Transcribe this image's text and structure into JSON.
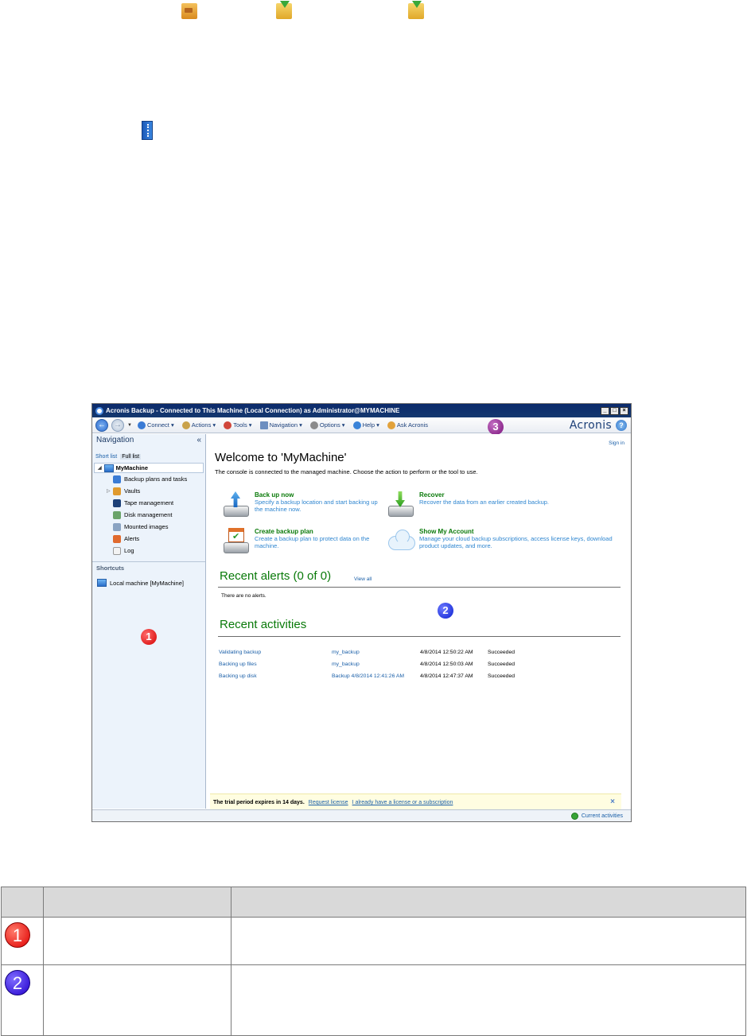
{
  "window": {
    "title": "Acronis Backup - Connected to This Machine (Local Connection) as Administrator@MYMACHINE",
    "buttons": [
      "_",
      "□",
      "×"
    ]
  },
  "toolbar": {
    "items": [
      "Connect ▾",
      "Actions ▾",
      "Tools ▾",
      "Navigation ▾",
      "Options ▾",
      "Help ▾",
      "Ask Acronis"
    ],
    "brand": "Acronis",
    "help_glyph": "?"
  },
  "navigation": {
    "title": "Navigation",
    "collapse_glyph": "«",
    "tabs": [
      "Short list",
      "Full list"
    ],
    "root": "MyMachine",
    "items": [
      "Backup plans and tasks",
      "Vaults",
      "Tape management",
      "Disk management",
      "Mounted images",
      "Alerts",
      "Log"
    ],
    "shortcuts_title": "Shortcuts",
    "shortcut": "Local machine [MyMachine]"
  },
  "main": {
    "sign_in": "Sign in",
    "welcome": "Welcome to 'MyMachine'",
    "subtitle": "The console is connected to the managed machine. Choose the action to perform or the tool to use.",
    "actions": [
      {
        "title": "Back up now",
        "desc": "Specify a backup location and start backing up the machine now."
      },
      {
        "title": "Recover",
        "desc": "Recover the data from an earlier created backup."
      },
      {
        "title": "Create backup plan",
        "desc": "Create a backup plan to protect data on the machine."
      },
      {
        "title": "Show My Account",
        "desc": "Manage your cloud backup subscriptions, access license keys, download product updates, and more."
      }
    ],
    "recent_alerts": "Recent alerts (0 of 0)",
    "view_all": "View all",
    "no_alerts": "There are no alerts.",
    "recent_activities": "Recent activities",
    "activities": [
      {
        "name": "Validating backup",
        "plan": "my_backup",
        "time": "4/8/2014 12:50:22 AM",
        "status": "Succeeded"
      },
      {
        "name": "Backing up files",
        "plan": "my_backup",
        "time": "4/8/2014 12:50:03 AM",
        "status": "Succeeded"
      },
      {
        "name": "Backing up disk",
        "plan": "Backup 4/8/2014 12:41:26 AM",
        "time": "4/8/2014 12:47:37 AM",
        "status": "Succeeded"
      }
    ],
    "trial_text": "The trial period expires in 14 days.",
    "request_license": "Request license",
    "have_license": "I already have a license or a subscription",
    "close_glyph": "×"
  },
  "status": {
    "current_activities": "Current activities"
  },
  "callouts": [
    "1",
    "2",
    "3"
  ],
  "table": {
    "row1_num": "1",
    "row2_num": "2"
  },
  "colors": {
    "title_bar": "#0b2a6b",
    "green_heading": "#0a7a0a",
    "link_blue": "#1a5fa8"
  }
}
